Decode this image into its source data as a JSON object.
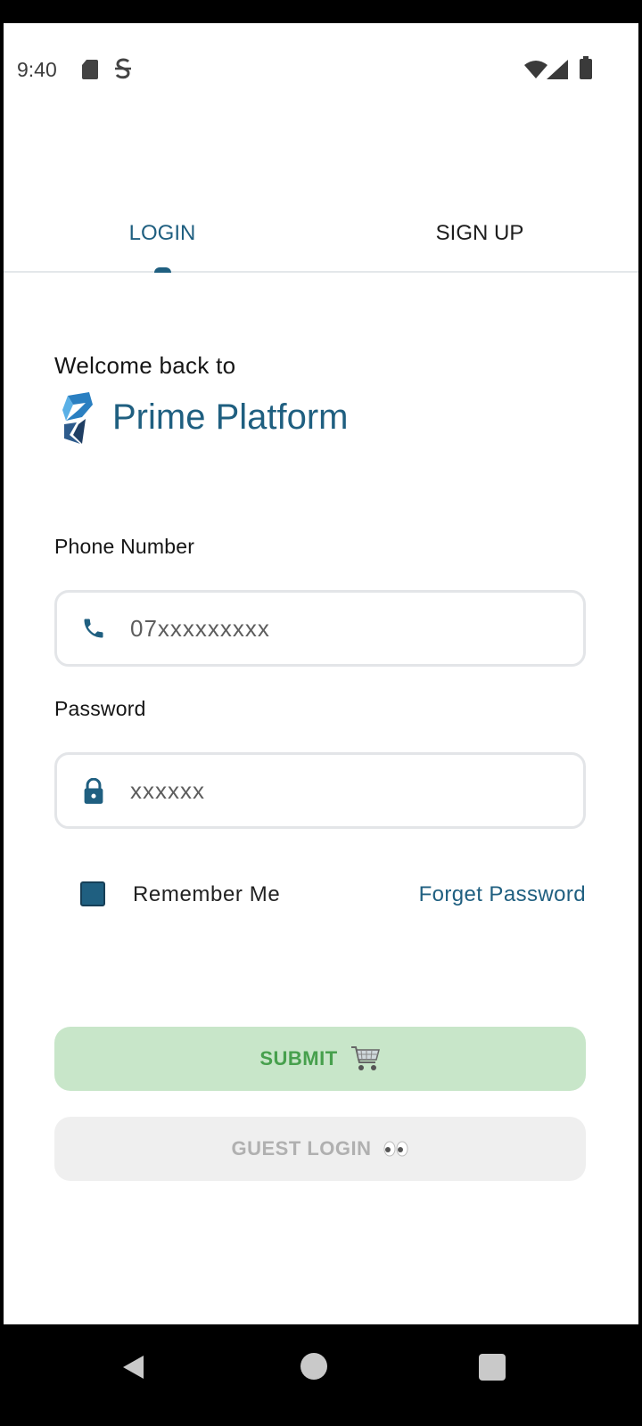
{
  "status_bar": {
    "time": "9:40",
    "icons": [
      "sd-card-icon",
      "s-notification-icon",
      "wifi-icon",
      "signal-icon",
      "battery-icon"
    ]
  },
  "tabs": [
    {
      "label": "LOGIN",
      "active": true
    },
    {
      "label": "SIGN UP",
      "active": false
    }
  ],
  "welcome": {
    "text": "Welcome back to",
    "brand": "Prime Platform"
  },
  "form": {
    "phone_label": "Phone Number",
    "phone_placeholder": "07xxxxxxxxx",
    "password_label": "Password",
    "password_placeholder": "xxxxxx",
    "remember_label": "Remember Me",
    "remember_checked": true,
    "forget_label": "Forget Password"
  },
  "buttons": {
    "submit_label": "SUBMIT",
    "guest_label": "GUEST LOGIN"
  },
  "colors": {
    "primary": "#1f5f80",
    "submit_bg": "#c8e6c9",
    "submit_text": "#47a04d",
    "guest_bg": "#efefef",
    "guest_text": "#b0b0b0"
  },
  "nav_bar": {
    "icons": [
      "back-icon",
      "home-icon",
      "recents-icon"
    ]
  }
}
